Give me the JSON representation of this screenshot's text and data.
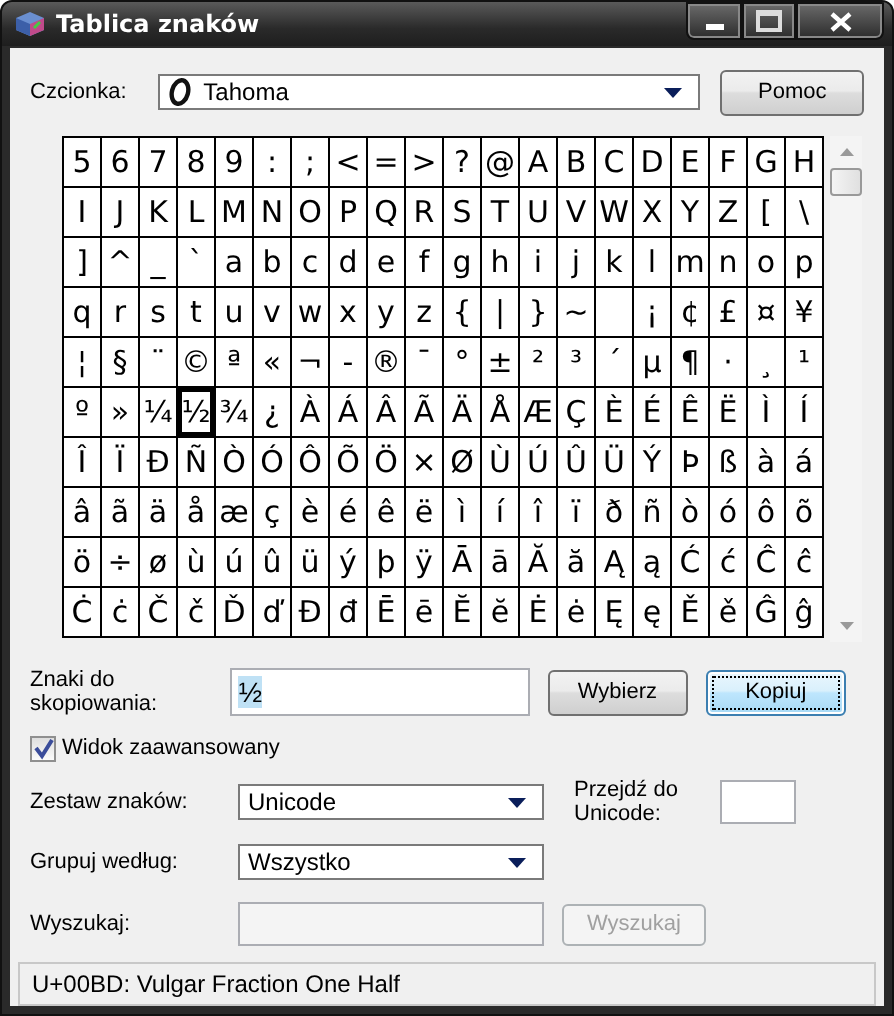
{
  "window": {
    "title": "Tablica znaków"
  },
  "font_row": {
    "label": "Czcionka:",
    "font": "Tahoma",
    "help_button": "Pomoc"
  },
  "grid": {
    "rows": [
      [
        "5",
        "6",
        "7",
        "8",
        "9",
        ":",
        ";",
        "<",
        "=",
        ">",
        "?",
        "@",
        "A",
        "B",
        "C",
        "D",
        "E",
        "F",
        "G",
        "H"
      ],
      [
        "I",
        "J",
        "K",
        "L",
        "M",
        "N",
        "O",
        "P",
        "Q",
        "R",
        "S",
        "T",
        "U",
        "V",
        "W",
        "X",
        "Y",
        "Z",
        "[",
        "\\"
      ],
      [
        "]",
        "^",
        "_",
        "`",
        "a",
        "b",
        "c",
        "d",
        "e",
        "f",
        "g",
        "h",
        "i",
        "j",
        "k",
        "l",
        "m",
        "n",
        "o",
        "p"
      ],
      [
        "q",
        "r",
        "s",
        "t",
        "u",
        "v",
        "w",
        "x",
        "y",
        "z",
        "{",
        "|",
        "}",
        "~",
        " ",
        "¡",
        "¢",
        "£",
        "¤",
        "¥"
      ],
      [
        "¦",
        "§",
        "¨",
        "©",
        "ª",
        "«",
        "¬",
        "-",
        "®",
        "¯",
        "°",
        "±",
        "²",
        "³",
        "´",
        "µ",
        "¶",
        "·",
        "¸",
        "¹"
      ],
      [
        "º",
        "»",
        "¼",
        "½",
        "¾",
        "¿",
        "À",
        "Á",
        "Â",
        "Ã",
        "Ä",
        "Å",
        "Æ",
        "Ç",
        "È",
        "É",
        "Ê",
        "Ë",
        "Ì",
        "Í"
      ],
      [
        "Î",
        "Ï",
        "Ð",
        "Ñ",
        "Ò",
        "Ó",
        "Ô",
        "Õ",
        "Ö",
        "×",
        "Ø",
        "Ù",
        "Ú",
        "Û",
        "Ü",
        "Ý",
        "Þ",
        "ß",
        "à",
        "á"
      ],
      [
        "â",
        "ã",
        "ä",
        "å",
        "æ",
        "ç",
        "è",
        "é",
        "ê",
        "ë",
        "ì",
        "í",
        "î",
        "ï",
        "ð",
        "ñ",
        "ò",
        "ó",
        "ô",
        "õ"
      ],
      [
        "ö",
        "÷",
        "ø",
        "ù",
        "ú",
        "û",
        "ü",
        "ý",
        "þ",
        "ÿ",
        "Ā",
        "ā",
        "Ă",
        "ă",
        "Ą",
        "ą",
        "Ć",
        "ć",
        "Ĉ",
        "ĉ"
      ],
      [
        "Ċ",
        "ċ",
        "Č",
        "č",
        "Ď",
        "ď",
        "Đ",
        "đ",
        "Ē",
        "ē",
        "Ĕ",
        "ĕ",
        "Ė",
        "ė",
        "Ę",
        "ę",
        "Ě",
        "ě",
        "Ĝ",
        "ĝ"
      ]
    ],
    "selected": [
      [
        false,
        false,
        false,
        false,
        false,
        false,
        false,
        false,
        false,
        false,
        false,
        false,
        false,
        false,
        false,
        false,
        false,
        false,
        false,
        false
      ],
      [
        false,
        false,
        false,
        false,
        false,
        false,
        false,
        false,
        false,
        false,
        false,
        false,
        false,
        false,
        false,
        false,
        false,
        false,
        false,
        false
      ],
      [
        false,
        false,
        false,
        false,
        false,
        false,
        false,
        false,
        false,
        false,
        false,
        false,
        false,
        false,
        false,
        false,
        false,
        false,
        false,
        false
      ],
      [
        false,
        false,
        false,
        false,
        false,
        false,
        false,
        false,
        false,
        false,
        false,
        false,
        false,
        false,
        false,
        false,
        false,
        false,
        false,
        false
      ],
      [
        false,
        false,
        false,
        false,
        false,
        false,
        false,
        false,
        false,
        false,
        false,
        false,
        false,
        false,
        false,
        false,
        false,
        false,
        false,
        false
      ],
      [
        false,
        false,
        false,
        true,
        false,
        false,
        false,
        false,
        false,
        false,
        false,
        false,
        false,
        false,
        false,
        false,
        false,
        false,
        false,
        false
      ],
      [
        false,
        false,
        false,
        false,
        false,
        false,
        false,
        false,
        false,
        false,
        false,
        false,
        false,
        false,
        false,
        false,
        false,
        false,
        false,
        false
      ],
      [
        false,
        false,
        false,
        false,
        false,
        false,
        false,
        false,
        false,
        false,
        false,
        false,
        false,
        false,
        false,
        false,
        false,
        false,
        false,
        false
      ],
      [
        false,
        false,
        false,
        false,
        false,
        false,
        false,
        false,
        false,
        false,
        false,
        false,
        false,
        false,
        false,
        false,
        false,
        false,
        false,
        false
      ],
      [
        false,
        false,
        false,
        false,
        false,
        false,
        false,
        false,
        false,
        false,
        false,
        false,
        false,
        false,
        false,
        false,
        false,
        false,
        false,
        false
      ]
    ]
  },
  "copy_row": {
    "label": "Znaki do skopiowania:",
    "value": "½",
    "select_button": "Wybierz",
    "copy_button": "Kopiuj"
  },
  "advanced_view": {
    "label": "Widok zaawansowany",
    "checked": true
  },
  "charset": {
    "label": "Zestaw znaków:",
    "value": "Unicode"
  },
  "goto_unicode": {
    "label": "Przejdź do Unicode:"
  },
  "group_by": {
    "label": "Grupuj według:",
    "value": "Wszystko"
  },
  "search": {
    "label": "Wyszukaj:",
    "button": "Wyszukaj",
    "disabled": true
  },
  "status_bar": "U+00BD: Vulgar Fraction One Half"
}
